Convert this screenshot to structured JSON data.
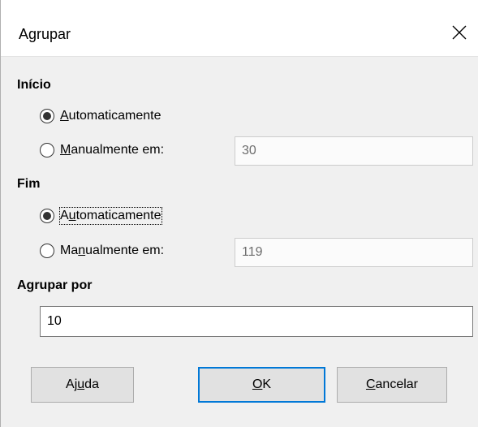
{
  "dialog": {
    "title": "Agrupar",
    "close_icon": "close-icon"
  },
  "start": {
    "heading": "Início",
    "auto_pre": "",
    "auto_ul": "A",
    "auto_post": "utomaticamente",
    "manual_pre": "",
    "manual_ul": "M",
    "manual_post": "anualmente em:",
    "value": "30",
    "selected": "automatic"
  },
  "end": {
    "heading": "Fim",
    "auto_pre": "A",
    "auto_ul": "u",
    "auto_post": "tomaticamente",
    "manual_pre": "Ma",
    "manual_ul": "n",
    "manual_post": "ualmente em:",
    "value": "119",
    "selected": "automatic"
  },
  "group_by": {
    "heading": "Agrupar por",
    "value": "10"
  },
  "buttons": {
    "help_pre": "Aj",
    "help_ul": "u",
    "help_post": "da",
    "ok_pre": "",
    "ok_ul": "O",
    "ok_post": "K",
    "cancel_pre": "",
    "cancel_ul": "C",
    "cancel_post": "ancelar"
  },
  "colors": {
    "accent": "#0078d7",
    "background": "#f0f0f0"
  }
}
